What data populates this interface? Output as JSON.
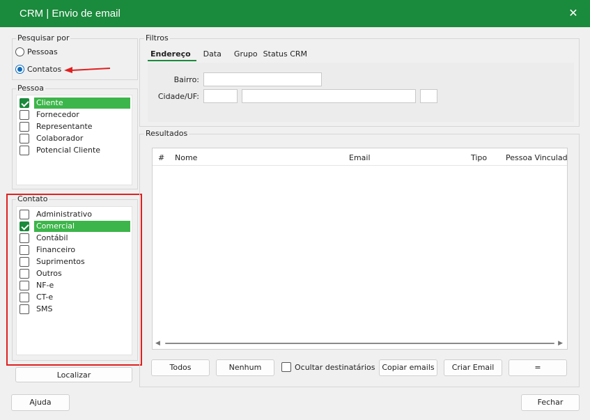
{
  "window": {
    "title": "CRM | Envio de email"
  },
  "search_by": {
    "legend": "Pesquisar por",
    "options": [
      {
        "label": "Pessoas",
        "selected": false
      },
      {
        "label": "Contatos",
        "selected": true
      }
    ]
  },
  "pessoa": {
    "legend": "Pessoa",
    "items": [
      {
        "label": "Cliente",
        "checked": true
      },
      {
        "label": "Fornecedor",
        "checked": false
      },
      {
        "label": "Representante",
        "checked": false
      },
      {
        "label": "Colaborador",
        "checked": false
      },
      {
        "label": "Potencial Cliente",
        "checked": false
      }
    ]
  },
  "contato": {
    "legend": "Contato",
    "items": [
      {
        "label": "Administrativo",
        "checked": false
      },
      {
        "label": "Comercial",
        "checked": true
      },
      {
        "label": "Contábil",
        "checked": false
      },
      {
        "label": "Financeiro",
        "checked": false
      },
      {
        "label": "Suprimentos",
        "checked": false
      },
      {
        "label": "Outros",
        "checked": false
      },
      {
        "label": "NF-e",
        "checked": false
      },
      {
        "label": "CT-e",
        "checked": false
      },
      {
        "label": "SMS",
        "checked": false
      }
    ]
  },
  "filtros": {
    "legend": "Filtros",
    "tabs": [
      "Endereço",
      "Data",
      "Grupo",
      "Status CRM"
    ],
    "active_tab": 0,
    "bairro_label": "Bairro:",
    "bairro_value": "",
    "cidade_label": "Cidade/UF:",
    "cidade_code": "",
    "cidade_name": "",
    "uf": ""
  },
  "resultados": {
    "legend": "Resultados",
    "columns": [
      "#",
      "Nome",
      "Email",
      "Tipo",
      "Pessoa Vinculada"
    ]
  },
  "buttons": {
    "localizar": "Localizar",
    "todos": "Todos",
    "nenhum": "Nenhum",
    "ocultar": "Ocultar destinatários",
    "copiar": "Copiar emails",
    "criar": "Criar Email",
    "equals": "=",
    "ajuda": "Ajuda",
    "fechar": "Fechar"
  },
  "colors": {
    "accent": "#1a8a3c",
    "selection": "#3cb54a",
    "annotation": "#e02020"
  }
}
